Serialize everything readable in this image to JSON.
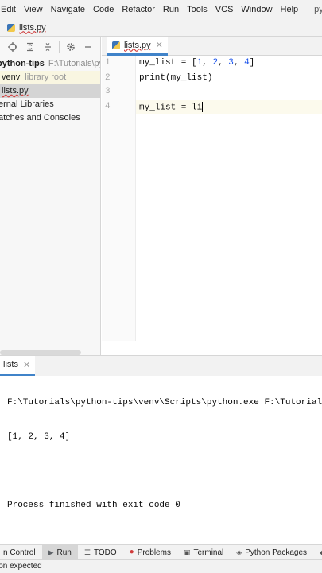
{
  "menu": [
    "Edit",
    "View",
    "Navigate",
    "Code",
    "Refactor",
    "Run",
    "Tools",
    "VCS",
    "Window",
    "Help"
  ],
  "app_title": "python-",
  "breadcrumb": "lists.py",
  "project": {
    "root_name": "python-tips",
    "root_path": "F:\\Tutorials\\python",
    "venv_name": "venv",
    "venv_hint": "library root",
    "file": "lists.py",
    "external_libraries": "ernal Libraries",
    "scratches": "atches and Consoles"
  },
  "editor": {
    "tab_label": "lists.py",
    "line_numbers": [
      "1",
      "2",
      "3",
      "4"
    ],
    "lines": [
      "my_list = [1, 2, 3, 4]",
      "print(my_list)",
      "",
      "my_list = li"
    ]
  },
  "run": {
    "tab_label": "lists",
    "output": [
      "F:\\Tutorials\\python-tips\\venv\\Scripts\\python.exe F:\\Tutorial",
      "[1, 2, 3, 4]",
      "",
      "Process finished with exit code 0"
    ]
  },
  "toolstrip": {
    "version_control": "n Control",
    "run": "Run",
    "todo": "TODO",
    "problems": "Problems",
    "terminal": "Terminal",
    "python_packages": "Python Packages",
    "python_console": "P"
  },
  "status": "ion expected",
  "colors": {
    "accent": "#4083c9",
    "error": "#d03c3c",
    "number": "#1750eb"
  }
}
